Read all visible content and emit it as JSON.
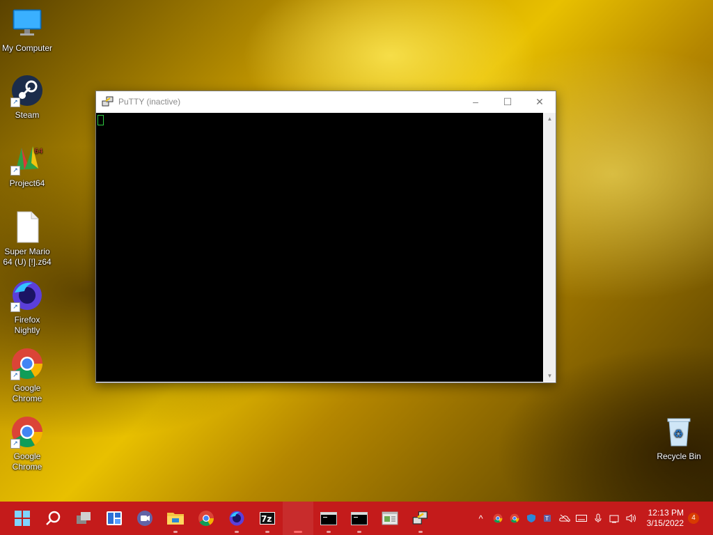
{
  "desktop": {
    "icons": [
      {
        "label": "My Computer"
      },
      {
        "label": "Steam"
      },
      {
        "label": "Project64"
      },
      {
        "label": "Super Mario 64 (U) [!].z64"
      },
      {
        "label": "Firefox Nightly"
      },
      {
        "label": "Google Chrome"
      },
      {
        "label": "Google Chrome"
      },
      {
        "label": "Recycle Bin"
      }
    ]
  },
  "window": {
    "title": "PuTTY (inactive)",
    "minimize": "–",
    "maximize": "☐",
    "close": "✕"
  },
  "taskbar": {
    "apps": [
      "start",
      "search",
      "task-view",
      "widgets",
      "teams-chat",
      "file-explorer",
      "google-chrome",
      "firefox-nightly",
      "7zip",
      "putty-config",
      "terminal",
      "terminal",
      "notepad",
      "putty"
    ],
    "tray": {
      "overflow": "^",
      "time": "12:13 PM",
      "date": "3/15/2022",
      "notifications": "4"
    }
  },
  "colors": {
    "taskbar": "#c41b1b",
    "terminal": "#000000",
    "cursor": "#2ecc40"
  }
}
